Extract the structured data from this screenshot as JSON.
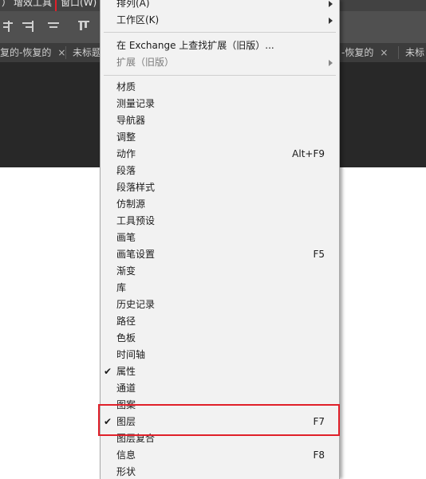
{
  "menubar": {
    "items": [
      "）",
      "增效工具",
      "窗口(W)"
    ]
  },
  "tabs": [
    {
      "label": "复的-恢复的",
      "close": "×"
    },
    {
      "label": "未标题",
      "close": ""
    },
    {
      "label": "-恢复的",
      "close": "×"
    },
    {
      "label": "未标",
      "close": ""
    }
  ],
  "menu": {
    "top": [
      {
        "label": "排列(A)",
        "submenu": true
      },
      {
        "label": "工作区(K)",
        "submenu": true
      }
    ],
    "ext": [
      {
        "label": "在 Exchange 上查找扩展（旧版）..."
      },
      {
        "label": "扩展（旧版）",
        "submenu": true,
        "disabled": true
      }
    ],
    "panels": [
      {
        "label": "材质",
        "shortcut": "",
        "checked": false
      },
      {
        "label": "测量记录",
        "shortcut": "",
        "checked": false
      },
      {
        "label": "导航器",
        "shortcut": "",
        "checked": false
      },
      {
        "label": "调整",
        "shortcut": "",
        "checked": false
      },
      {
        "label": "动作",
        "shortcut": "Alt+F9",
        "checked": false
      },
      {
        "label": "段落",
        "shortcut": "",
        "checked": false
      },
      {
        "label": "段落样式",
        "shortcut": "",
        "checked": false
      },
      {
        "label": "仿制源",
        "shortcut": "",
        "checked": false
      },
      {
        "label": "工具预设",
        "shortcut": "",
        "checked": false
      },
      {
        "label": "画笔",
        "shortcut": "",
        "checked": false
      },
      {
        "label": "画笔设置",
        "shortcut": "F5",
        "checked": false
      },
      {
        "label": "渐变",
        "shortcut": "",
        "checked": false
      },
      {
        "label": "库",
        "shortcut": "",
        "checked": false
      },
      {
        "label": "历史记录",
        "shortcut": "",
        "checked": false
      },
      {
        "label": "路径",
        "shortcut": "",
        "checked": false
      },
      {
        "label": "色板",
        "shortcut": "",
        "checked": false
      },
      {
        "label": "时间轴",
        "shortcut": "",
        "checked": false
      },
      {
        "label": "属性",
        "shortcut": "",
        "checked": true
      },
      {
        "label": "通道",
        "shortcut": "",
        "checked": false
      },
      {
        "label": "图案",
        "shortcut": "",
        "checked": false
      },
      {
        "label": "图层",
        "shortcut": "F7",
        "checked": true
      },
      {
        "label": "图层复合",
        "shortcut": "",
        "checked": false
      },
      {
        "label": "信息",
        "shortcut": "F8",
        "checked": false
      },
      {
        "label": "形状",
        "shortcut": "",
        "checked": false
      }
    ]
  },
  "colors": {
    "highlight": "#e0202a",
    "menu_bg": "#f2f2f2",
    "app_bg": "#2a2a2a"
  }
}
